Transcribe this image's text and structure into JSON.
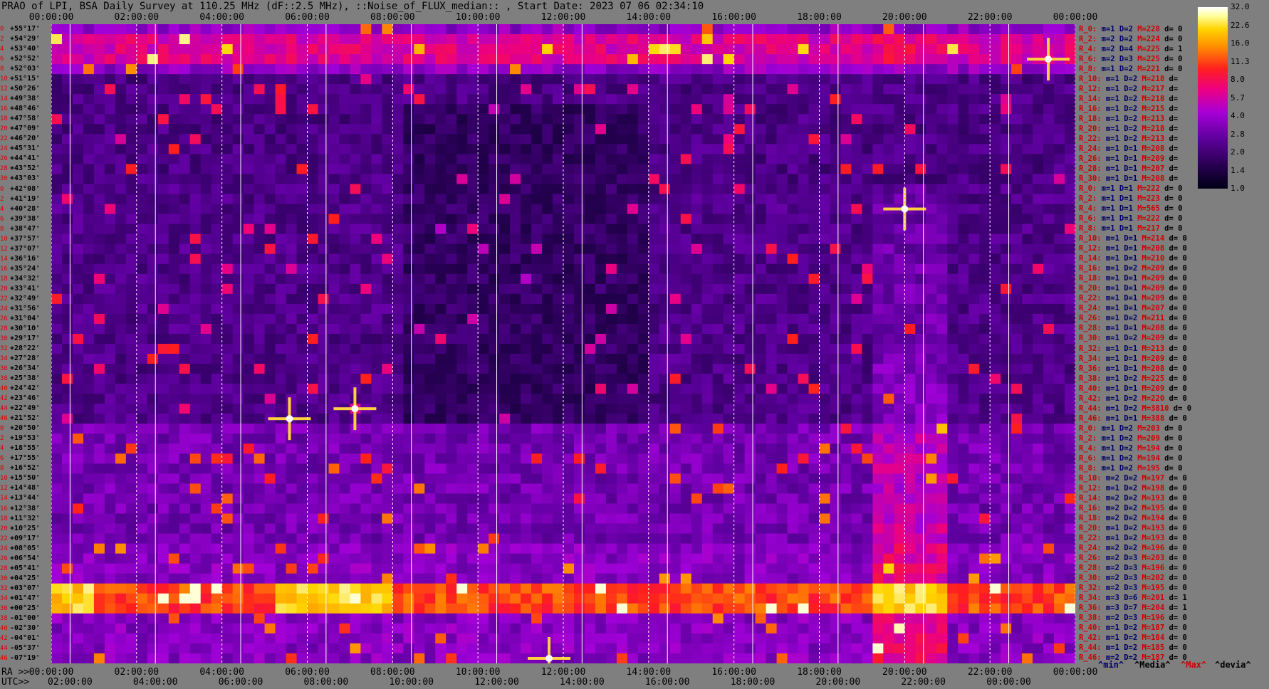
{
  "title": "PRAO of LPI, BSA Daily Survey at 110.25 MHz (dF::2.5 MHz), ::Noise_of_FLUX_median:: , Start Date: 2023 07 06 02:34:10",
  "chart_data": {
    "type": "heatmap",
    "title": "PRAO of LPI, BSA Daily Survey at 110.25 MHz (dF::2.5 MHz), ::Noise_of_FLUX_median:: , Start Date: 2023 07 06 02:34:10",
    "x_top_ticks": [
      "00:00:00",
      "02:00:00",
      "04:00:00",
      "06:00:00",
      "08:00:00",
      "10:00:00",
      "12:00:00",
      "14:00:00",
      "16:00:00",
      "18:00:00",
      "20:00:00",
      "22:00:00",
      "00:00:00"
    ],
    "x_bottom_ra_label": "RA >>",
    "x_bottom_ra_ticks": [
      "00:00:00",
      "02:00:00",
      "04:00:00",
      "06:00:00",
      "08:00:00",
      "10:00:00",
      "12:00:00",
      "14:00:00",
      "16:00:00",
      "18:00:00",
      "20:00:00",
      "22:00:00",
      "00:00:00"
    ],
    "x_bottom_utc_label": "UTC>>",
    "x_bottom_utc_ticks": [
      "04:00:00",
      "06:00:00",
      "08:00:00",
      "10:00:00",
      "12:00:00",
      "14:00:00",
      "16:00:00",
      "18:00:00",
      "20:00:00",
      "22:00:00",
      "00:00:00",
      "02:00:00"
    ],
    "declinations": [
      "+55°17'",
      "+54°29'",
      "+53°40'",
      "+52°52'",
      "+52°03'",
      "+51°15'",
      "+50°26'",
      "+49°38'",
      "+48°46'",
      "+47°58'",
      "+47°09'",
      "+46°20'",
      "+45°31'",
      "+44°41'",
      "+43°52'",
      "+43°03'",
      "+42°08'",
      "+41°19'",
      "+40°28'",
      "+39°38'",
      "+38°47'",
      "+37°57'",
      "+37°07'",
      "+36°16'",
      "+35°24'",
      "+34°32'",
      "+33°41'",
      "+32°49'",
      "+31°56'",
      "+31°04'",
      "+30°10'",
      "+29°17'",
      "+28°22'",
      "+27°28'",
      "+26°34'",
      "+25°38'",
      "+24°42'",
      "+23°46'",
      "+22°49'",
      "+21°52'",
      "+20°50'",
      "+19°53'",
      "+18°55'",
      "+17°55'",
      "+16°52'",
      "+15°50'",
      "+14°48'",
      "+13°44'",
      "+12°38'",
      "+11°32'",
      "+10°25'",
      "+09°17'",
      "+08°05'",
      "+06°54'",
      "+05°41'",
      "+04°25'",
      "+03°07'",
      "+01°47'",
      "+00°25'",
      "-01°00'",
      "-02°30'",
      "-04°01'",
      "-05°37'",
      "-07°19'"
    ],
    "row_numbers": [
      "0",
      "2",
      "4",
      "6",
      "8",
      "10",
      "12",
      "14",
      "16",
      "18",
      "20",
      "22",
      "24",
      "26",
      "28",
      "30",
      "0",
      "2",
      "4",
      "6",
      "8",
      "10",
      "12",
      "14",
      "16",
      "18",
      "20",
      "22",
      "24",
      "26",
      "28",
      "30",
      "32",
      "34",
      "36",
      "38",
      "40",
      "42",
      "44",
      "46",
      "0",
      "2",
      "4",
      "6",
      "8",
      "10",
      "12",
      "14",
      "16",
      "18",
      "20",
      "22",
      "24",
      "26",
      "28",
      "30",
      "32",
      "34",
      "36",
      "38",
      "40",
      "42",
      "44",
      "46"
    ],
    "colorbar": {
      "ticks": [
        "32.0",
        "22.6",
        "16.0",
        "11.3",
        "8.0",
        "5.7",
        "4.0",
        "2.8",
        "2.0",
        "1.4",
        "1.0"
      ]
    },
    "bright_sources": [
      {
        "ra": "07:07",
        "dec": "+22°49'"
      },
      {
        "ra": "20:00",
        "dec": "+40°28'"
      },
      {
        "ra": "05:35",
        "dec": "+21°52'"
      },
      {
        "ra": "23:22",
        "dec": "+52°52'"
      },
      {
        "ra": "11:40",
        "dec": "-07°19'"
      }
    ],
    "legend": {
      "min": "^min^",
      "median": "^Media^",
      "max": "^Max^",
      "dev": "^devia^"
    }
  },
  "stats": [
    {
      "r": "R_0:",
      "m": "1",
      "D": "2",
      "M": "228",
      "d": "0"
    },
    {
      "r": "R_2:",
      "m": "2",
      "D": "2",
      "M": "224",
      "d": "0"
    },
    {
      "r": "R_4:",
      "m": "2",
      "D": "4",
      "M": "225",
      "d": "1"
    },
    {
      "r": "R_6:",
      "m": "2",
      "D": "3",
      "M": "225",
      "d": "0"
    },
    {
      "r": "R_8:",
      "m": "1",
      "D": "2",
      "M": "221",
      "d": "0"
    },
    {
      "r": "R_10:",
      "m": "1",
      "D": "2",
      "M": "218",
      "d": ""
    },
    {
      "r": "R_12:",
      "m": "1",
      "D": "2",
      "M": "217",
      "d": ""
    },
    {
      "r": "R_14:",
      "m": "1",
      "D": "2",
      "M": "218",
      "d": ""
    },
    {
      "r": "R_16:",
      "m": "1",
      "D": "2",
      "M": "215",
      "d": ""
    },
    {
      "r": "R_18:",
      "m": "1",
      "D": "2",
      "M": "213",
      "d": ""
    },
    {
      "r": "R_20:",
      "m": "1",
      "D": "2",
      "M": "218",
      "d": ""
    },
    {
      "r": "R_22:",
      "m": "1",
      "D": "2",
      "M": "213",
      "d": ""
    },
    {
      "r": "R_24:",
      "m": "1",
      "D": "1",
      "M": "208",
      "d": ""
    },
    {
      "r": "R_26:",
      "m": "1",
      "D": "1",
      "M": "209",
      "d": ""
    },
    {
      "r": "R_28:",
      "m": "1",
      "D": "1",
      "M": "207",
      "d": ""
    },
    {
      "r": "R_30:",
      "m": "1",
      "D": "1",
      "M": "208",
      "d": ""
    },
    {
      "r": "R_0:",
      "m": "1",
      "D": "1",
      "M": "222",
      "d": "0"
    },
    {
      "r": "R_2:",
      "m": "1",
      "D": "1",
      "M": "223",
      "d": "0"
    },
    {
      "r": "R_4:",
      "m": "1",
      "D": "1",
      "M": "565",
      "d": "0"
    },
    {
      "r": "R_6:",
      "m": "1",
      "D": "1",
      "M": "222",
      "d": "0"
    },
    {
      "r": "R_8:",
      "m": "1",
      "D": "1",
      "M": "217",
      "d": "0"
    },
    {
      "r": "R_10:",
      "m": "1",
      "D": "1",
      "M": "214",
      "d": "0"
    },
    {
      "r": "R_12:",
      "m": "1",
      "D": "1",
      "M": "208",
      "d": "0"
    },
    {
      "r": "R_14:",
      "m": "1",
      "D": "1",
      "M": "210",
      "d": "0"
    },
    {
      "r": "R_16:",
      "m": "1",
      "D": "2",
      "M": "209",
      "d": "0"
    },
    {
      "r": "R_18:",
      "m": "1",
      "D": "1",
      "M": "209",
      "d": "0"
    },
    {
      "r": "R_20:",
      "m": "1",
      "D": "1",
      "M": "209",
      "d": "0"
    },
    {
      "r": "R_22:",
      "m": "1",
      "D": "1",
      "M": "209",
      "d": "0"
    },
    {
      "r": "R_24:",
      "m": "1",
      "D": "1",
      "M": "207",
      "d": "0"
    },
    {
      "r": "R_26:",
      "m": "1",
      "D": "2",
      "M": "211",
      "d": "0"
    },
    {
      "r": "R_28:",
      "m": "1",
      "D": "1",
      "M": "208",
      "d": "0"
    },
    {
      "r": "R_30:",
      "m": "1",
      "D": "2",
      "M": "209",
      "d": "0"
    },
    {
      "r": "R_32:",
      "m": "1",
      "D": "1",
      "M": "213",
      "d": "0"
    },
    {
      "r": "R_34:",
      "m": "1",
      "D": "1",
      "M": "209",
      "d": "0"
    },
    {
      "r": "R_36:",
      "m": "1",
      "D": "1",
      "M": "208",
      "d": "0"
    },
    {
      "r": "R_38:",
      "m": "1",
      "D": "2",
      "M": "225",
      "d": "0"
    },
    {
      "r": "R_40:",
      "m": "1",
      "D": "1",
      "M": "209",
      "d": "0"
    },
    {
      "r": "R_42:",
      "m": "1",
      "D": "2",
      "M": "220",
      "d": "0"
    },
    {
      "r": "R_44:",
      "m": "1",
      "D": "2",
      "M": "3810",
      "d": "0"
    },
    {
      "r": "R_46:",
      "m": "1",
      "D": "1",
      "M": "388",
      "d": "0"
    },
    {
      "r": "R_0:",
      "m": "1",
      "D": "2",
      "M": "203",
      "d": "0"
    },
    {
      "r": "R_2:",
      "m": "1",
      "D": "2",
      "M": "209",
      "d": "0"
    },
    {
      "r": "R_4:",
      "m": "1",
      "D": "2",
      "M": "194",
      "d": "0"
    },
    {
      "r": "R_6:",
      "m": "1",
      "D": "2",
      "M": "194",
      "d": "0"
    },
    {
      "r": "R_8:",
      "m": "1",
      "D": "2",
      "M": "195",
      "d": "0"
    },
    {
      "r": "R_10:",
      "m": "2",
      "D": "2",
      "M": "197",
      "d": "0"
    },
    {
      "r": "R_12:",
      "m": "1",
      "D": "2",
      "M": "198",
      "d": "0"
    },
    {
      "r": "R_14:",
      "m": "2",
      "D": "2",
      "M": "193",
      "d": "0"
    },
    {
      "r": "R_16:",
      "m": "2",
      "D": "2",
      "M": "195",
      "d": "0"
    },
    {
      "r": "R_18:",
      "m": "2",
      "D": "2",
      "M": "194",
      "d": "0"
    },
    {
      "r": "R_20:",
      "m": "1",
      "D": "2",
      "M": "193",
      "d": "0"
    },
    {
      "r": "R_22:",
      "m": "1",
      "D": "2",
      "M": "193",
      "d": "0"
    },
    {
      "r": "R_24:",
      "m": "2",
      "D": "2",
      "M": "196",
      "d": "0"
    },
    {
      "r": "R_26:",
      "m": "2",
      "D": "3",
      "M": "203",
      "d": "0"
    },
    {
      "r": "R_28:",
      "m": "2",
      "D": "3",
      "M": "196",
      "d": "0"
    },
    {
      "r": "R_30:",
      "m": "2",
      "D": "3",
      "M": "202",
      "d": "0"
    },
    {
      "r": "R_32:",
      "m": "2",
      "D": "3",
      "M": "195",
      "d": "0"
    },
    {
      "r": "R_34:",
      "m": "3",
      "D": "6",
      "M": "201",
      "d": "1"
    },
    {
      "r": "R_36:",
      "m": "3",
      "D": "7",
      "M": "204",
      "d": "1"
    },
    {
      "r": "R_38:",
      "m": "2",
      "D": "3",
      "M": "196",
      "d": "0"
    },
    {
      "r": "R_40:",
      "m": "1",
      "D": "2",
      "M": "187",
      "d": "0"
    },
    {
      "r": "R_42:",
      "m": "1",
      "D": "2",
      "M": "184",
      "d": "0"
    },
    {
      "r": "R_44:",
      "m": "1",
      "D": "2",
      "M": "185",
      "d": "0"
    },
    {
      "r": "R_46:",
      "m": "2",
      "D": "2",
      "M": "187",
      "d": "0"
    }
  ]
}
